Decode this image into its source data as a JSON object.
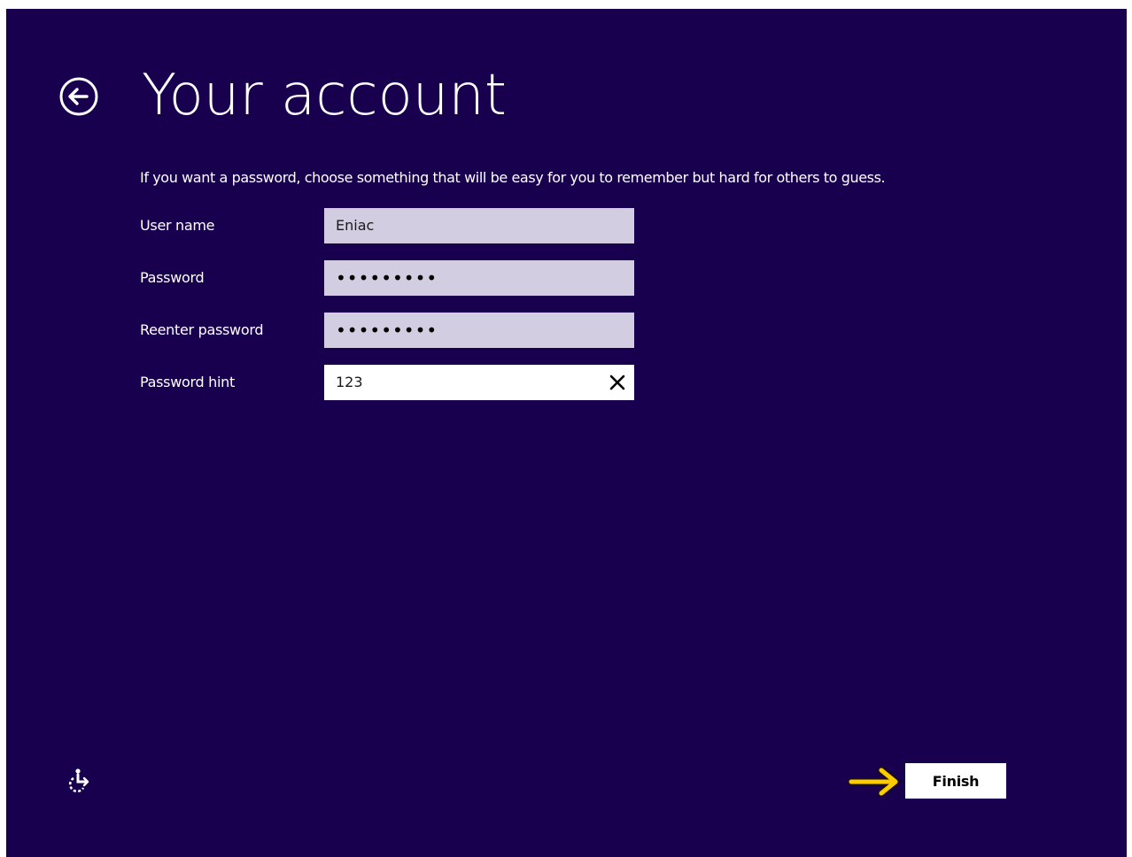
{
  "header": {
    "title": "Your account",
    "back_icon": "back-arrow-circle-icon"
  },
  "instructions": "If you want a password, choose something that will be easy for you to remember but hard for others to guess.",
  "form": {
    "user_name": {
      "label": "User name",
      "value": "Eniac"
    },
    "password": {
      "label": "Password",
      "value": "•••••••••"
    },
    "reenter_password": {
      "label": "Reenter password",
      "value": "•••••••••"
    },
    "password_hint": {
      "label": "Password hint",
      "value": "123",
      "clear_icon": "close-icon"
    }
  },
  "footer": {
    "ease_of_access_icon": "ease-of-access-icon",
    "annotation_icon": "arrow-right-icon",
    "finish_label": "Finish"
  },
  "colors": {
    "background": "#18004e",
    "field_inactive": "#d2cde0",
    "field_active": "#ffffff",
    "annotation_arrow": "#ffcc00"
  }
}
